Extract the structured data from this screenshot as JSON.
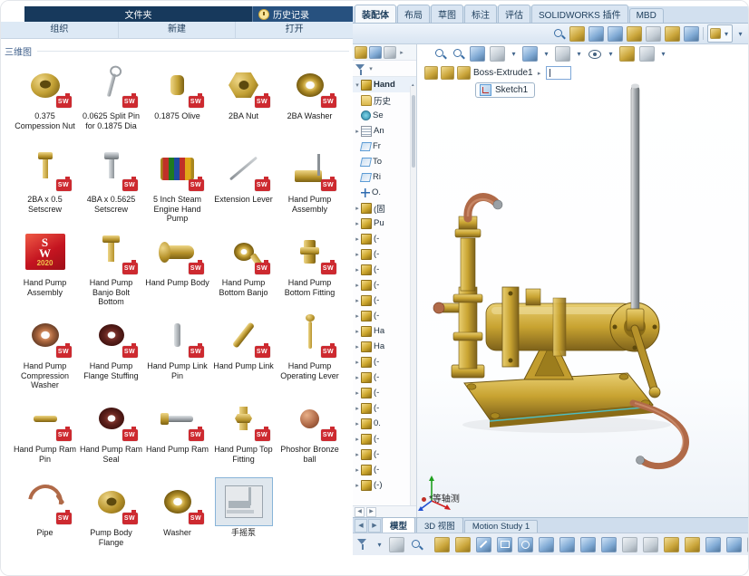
{
  "icons": {
    "expand": "▸",
    "collapse": "▾",
    "caret_up": "▴",
    "dropdown": "▾",
    "scroll_left": "◀",
    "scroll_right": "▶",
    "breadcrumb_arrow": "▸"
  },
  "explorer": {
    "ribbon": {
      "folder_tab": "文件夹",
      "history_button": "历史记录",
      "groups": [
        "组织",
        "新建",
        "打开"
      ]
    },
    "section_title": "三维图",
    "badge_text": "SW",
    "sw_logo": {
      "s": "S",
      "w": "W",
      "year": "2020"
    },
    "items": [
      {
        "label": "0.375 Compession Nut",
        "shape": "roundnut",
        "badge": true
      },
      {
        "label": "0.0625 Split Pin for 0.1875 Dia",
        "shape": "splitpin",
        "badge": true
      },
      {
        "label": "0.1875 Olive",
        "shape": "olive",
        "badge": true
      },
      {
        "label": "2BA Nut",
        "shape": "hexnut",
        "badge": true
      },
      {
        "label": "2BA Washer",
        "shape": "ring-g",
        "badge": true
      },
      {
        "label": "2BA x 0.5 Setscrew",
        "shape": "screw-g",
        "badge": true
      },
      {
        "label": "4BA x 0.5625 Setscrew",
        "shape": "screw-s",
        "badge": true
      },
      {
        "label": "5 Inch Steam Engine Hand Pump",
        "shape": "stripes",
        "badge": true
      },
      {
        "label": "Extension Lever",
        "shape": "lever",
        "badge": true
      },
      {
        "label": "Hand Pump Assembly",
        "shape": "minipump",
        "badge": true
      },
      {
        "label": "Hand Pump Assembly",
        "shape": "swlogo",
        "badge": false
      },
      {
        "label": "Hand Pump Banjo Bolt Bottom",
        "shape": "bolt",
        "badge": true
      },
      {
        "label": "Hand Pump Body",
        "shape": "hbody",
        "badge": true
      },
      {
        "label": "Hand Pump Bottom Banjo",
        "shape": "banjo",
        "badge": true
      },
      {
        "label": "Hand Pump Bottom Fitting",
        "shape": "vfit",
        "badge": true
      },
      {
        "label": "Hand Pump Compression Washer",
        "shape": "ring-c",
        "badge": true
      },
      {
        "label": "Hand Pump Flange Stuffing",
        "shape": "ring-m",
        "badge": true
      },
      {
        "label": "Hand Pump Link Pin",
        "shape": "pin-s",
        "badge": true
      },
      {
        "label": "Hand Pump Link",
        "shape": "bar",
        "badge": true
      },
      {
        "label": "Hand Pump Operating Lever",
        "shape": "oplever",
        "badge": true
      },
      {
        "label": "Hand Pump Ram Pin",
        "shape": "hpin",
        "badge": true
      },
      {
        "label": "Hand Pump Ram Seal",
        "shape": "ring-m",
        "badge": true
      },
      {
        "label": "Hand Pump Ram",
        "shape": "ram",
        "badge": true
      },
      {
        "label": "Hand Pump Top Fitting",
        "shape": "hexfit",
        "badge": true
      },
      {
        "label": "Phoshor Bronze ball",
        "shape": "ball",
        "badge": true
      },
      {
        "label": "Pipe",
        "shape": "pipe",
        "badge": true
      },
      {
        "label": "Pump Body Flange",
        "shape": "flange",
        "badge": true
      },
      {
        "label": "Washer",
        "shape": "ring-g",
        "badge": true
      },
      {
        "label": "手摇泵",
        "shape": "graypump",
        "badge": false,
        "selected": true
      }
    ]
  },
  "sw": {
    "ribbon_tabs": [
      {
        "label": "装配体",
        "active": true
      },
      {
        "label": "布局",
        "active": false
      },
      {
        "label": "草图",
        "active": false
      },
      {
        "label": "标注",
        "active": false
      },
      {
        "label": "评估",
        "active": false
      },
      {
        "label": "SOLIDWORKS 插件",
        "active": false
      },
      {
        "label": "MBD",
        "active": false
      }
    ],
    "toolbar_icons": [
      {
        "name": "search-icon",
        "style": "mag"
      },
      {
        "name": "insert-component-icon",
        "style": "gold"
      },
      {
        "name": "mate-icon",
        "style": "blue"
      },
      {
        "name": "component-pattern-icon",
        "style": "blue"
      },
      {
        "name": "smart-fasteners-icon",
        "style": "gold"
      },
      {
        "name": "move-component-icon",
        "style": "grey"
      },
      {
        "name": "assembly-features-icon",
        "style": "gold"
      },
      {
        "name": "reference-geometry-icon",
        "style": "blue"
      },
      {
        "name": "separator",
        "style": "sep"
      },
      {
        "name": "display-settings-button",
        "style": "boxed"
      },
      {
        "name": "dropdown-arrow-icon",
        "style": "drop"
      }
    ],
    "hud_icons": [
      {
        "name": "zoom-fit-icon",
        "style": "mag"
      },
      {
        "name": "zoom-area-icon",
        "style": "mag"
      },
      {
        "name": "previous-view-icon",
        "style": "blue"
      },
      {
        "name": "section-view-icon",
        "style": "grey"
      },
      {
        "name": "dropdown-arrow-icon",
        "style": "drop"
      },
      {
        "name": "view-orientation-icon",
        "style": "blue"
      },
      {
        "name": "dropdown-arrow-icon",
        "style": "drop"
      },
      {
        "name": "display-style-icon",
        "style": "grey"
      },
      {
        "name": "dropdown-arrow-icon",
        "style": "drop"
      },
      {
        "name": "hide-show-items-icon",
        "style": "eye"
      },
      {
        "name": "dropdown-arrow-icon",
        "style": "drop"
      },
      {
        "name": "edit-appearance-icon",
        "style": "gold"
      },
      {
        "name": "apply-scene-icon",
        "style": "grey"
      },
      {
        "name": "dropdown-arrow-icon",
        "style": "drop"
      }
    ],
    "breadcrumb": {
      "feature": "Boss-Extrude1",
      "sketch": "Sketch1"
    },
    "tree": {
      "root": "Hand",
      "items": [
        {
          "icon": "folder",
          "label": "历史",
          "expand": false
        },
        {
          "icon": "sensor",
          "label": "Se",
          "expand": false
        },
        {
          "icon": "note",
          "label": "An",
          "expand": true
        },
        {
          "icon": "plane",
          "label": "Fr",
          "expand": false
        },
        {
          "icon": "plane",
          "label": "To",
          "expand": false
        },
        {
          "icon": "plane",
          "label": "Ri",
          "expand": false
        },
        {
          "icon": "origin",
          "label": "O.",
          "expand": false
        },
        {
          "icon": "part",
          "label": "(固",
          "expand": true
        },
        {
          "icon": "part",
          "label": "Pu",
          "expand": true
        },
        {
          "icon": "part",
          "label": "(-",
          "expand": true
        },
        {
          "icon": "part",
          "label": "(-",
          "expand": true
        },
        {
          "icon": "part",
          "label": "(-",
          "expand": true
        },
        {
          "icon": "part",
          "label": "(-",
          "expand": true
        },
        {
          "icon": "part",
          "label": "(-",
          "expand": true
        },
        {
          "icon": "part",
          "label": "(-",
          "expand": true
        },
        {
          "icon": "part",
          "label": "Ha",
          "expand": true
        },
        {
          "icon": "part",
          "label": "Ha",
          "expand": true
        },
        {
          "icon": "part",
          "label": "(-",
          "expand": true
        },
        {
          "icon": "part",
          "label": "(-",
          "expand": true
        },
        {
          "icon": "part",
          "label": "(-",
          "expand": true
        },
        {
          "icon": "part",
          "label": "(-",
          "expand": true
        },
        {
          "icon": "part",
          "label": "0.",
          "expand": true
        },
        {
          "icon": "part",
          "label": "(-",
          "expand": true
        },
        {
          "icon": "part",
          "label": "(-",
          "expand": true
        },
        {
          "icon": "part",
          "label": "(-",
          "expand": true
        },
        {
          "icon": "part",
          "label": "(-)",
          "expand": true
        }
      ]
    },
    "view_label": "*等轴测",
    "bottom_tabs": [
      {
        "label": "模型",
        "active": true
      },
      {
        "label": "3D 视图",
        "active": false
      },
      {
        "label": "Motion Study 1",
        "active": false
      }
    ],
    "status_icons_left": [
      {
        "name": "selection-filter-icon",
        "style": "funnel"
      },
      {
        "name": "dropdown-arrow-icon",
        "style": "drop"
      },
      {
        "name": "quick-filter-icon",
        "style": "grey"
      },
      {
        "name": "magnifier-icon",
        "style": "mag"
      }
    ],
    "status_icons_right": [
      {
        "name": "sketch-icon",
        "style": "gold"
      },
      {
        "name": "smart-dimension-icon",
        "style": "gold"
      },
      {
        "name": "line-icon",
        "style": "line"
      },
      {
        "name": "rectangle-icon",
        "style": "rect"
      },
      {
        "name": "circle-icon",
        "style": "circle"
      },
      {
        "name": "arc-icon",
        "style": "blue"
      },
      {
        "name": "polygon-icon",
        "style": "blue"
      },
      {
        "name": "spline-icon",
        "style": "blue"
      },
      {
        "name": "point-icon",
        "style": "blue"
      },
      {
        "name": "text-icon",
        "style": "grey"
      },
      {
        "name": "trim-entities-icon",
        "style": "grey"
      },
      {
        "name": "convert-entities-icon",
        "style": "gold"
      },
      {
        "name": "offset-entities-icon",
        "style": "gold"
      },
      {
        "name": "mirror-entities-icon",
        "style": "blue"
      },
      {
        "name": "linear-pattern-icon",
        "style": "blue"
      },
      {
        "name": "display-relations-icon",
        "style": "grey"
      }
    ],
    "colors": {
      "brass": "#c8a331",
      "copper": "#b06a48",
      "steel": "#9aa0a5",
      "highlight_cyan": "#45c8d8",
      "badge_red": "#cd2a30"
    }
  }
}
